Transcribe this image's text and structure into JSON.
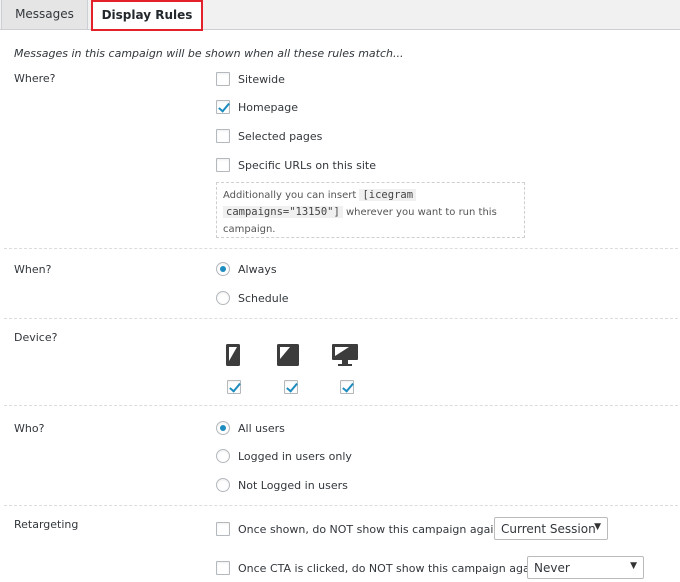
{
  "tabs": {
    "messages": "Messages",
    "display_rules": "Display Rules"
  },
  "intro": "Messages in this campaign will be shown when all these rules match...",
  "where": {
    "label": "Where?",
    "options": [
      {
        "label": "Sitewide",
        "checked": false
      },
      {
        "label": "Homepage",
        "checked": true
      },
      {
        "label": "Selected pages",
        "checked": false
      },
      {
        "label": "Specific URLs on this site",
        "checked": false
      }
    ],
    "info_prefix": "Additionally you can insert",
    "info_code_1": "[icegram",
    "info_code_2": "campaigns=\"13150\"]",
    "info_suffix": "wherever you want to run this",
    "info_suffix_2": "campaign."
  },
  "when": {
    "label": "When?",
    "options": [
      {
        "label": "Always",
        "checked": true
      },
      {
        "label": "Schedule",
        "checked": false
      }
    ]
  },
  "device": {
    "label": "Device?",
    "devices": [
      {
        "icon": "mobile-icon",
        "checked": true
      },
      {
        "icon": "tablet-icon",
        "checked": true
      },
      {
        "icon": "desktop-icon",
        "checked": true
      }
    ]
  },
  "who": {
    "label": "Who?",
    "options": [
      {
        "label": "All users",
        "checked": true
      },
      {
        "label": "Logged in users only",
        "checked": false
      },
      {
        "label": "Not Logged in users",
        "checked": false
      }
    ]
  },
  "retargeting": {
    "label": "Retargeting",
    "shown_label": "Once shown, do NOT show this campaign again for",
    "shown_value": "Current Session",
    "cta_label": "Once CTA is clicked, do NOT show this campaign again for",
    "cta_value": "Never"
  },
  "colors": {
    "accent": "#1e8cbe",
    "active_tab_border": "#e3212b"
  }
}
